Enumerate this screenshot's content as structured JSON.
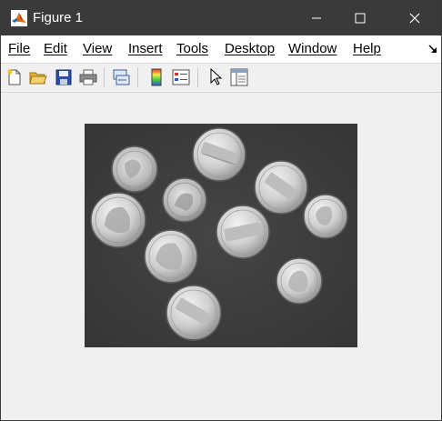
{
  "window": {
    "title": "Figure 1",
    "icon": "matlab-logo-icon"
  },
  "titlebar_controls": {
    "minimize_icon": "minimize-icon",
    "maximize_icon": "maximize-icon",
    "close_icon": "close-icon"
  },
  "menu": {
    "items": [
      {
        "accel": "F",
        "rest": "ile"
      },
      {
        "accel": "E",
        "rest": "dit"
      },
      {
        "accel": "V",
        "rest": "iew"
      },
      {
        "accel": "I",
        "rest": "nsert"
      },
      {
        "accel": "T",
        "rest": "ools"
      },
      {
        "accel": "D",
        "rest": "esktop"
      },
      {
        "accel": "W",
        "rest": "indow"
      },
      {
        "accel": "H",
        "rest": "elp"
      }
    ],
    "dock_icon": "dock-arrow-icon"
  },
  "toolbar": {
    "buttons": [
      "new-figure-icon",
      "open-file-icon",
      "save-icon",
      "print-icon",
      "link-plot-icon",
      "insert-colorbar-icon",
      "insert-legend-icon",
      "edit-plot-pointer-icon",
      "property-inspector-icon"
    ]
  },
  "figure": {
    "content": "grayscale-image-of-coins",
    "background": "#3e3e3e"
  }
}
